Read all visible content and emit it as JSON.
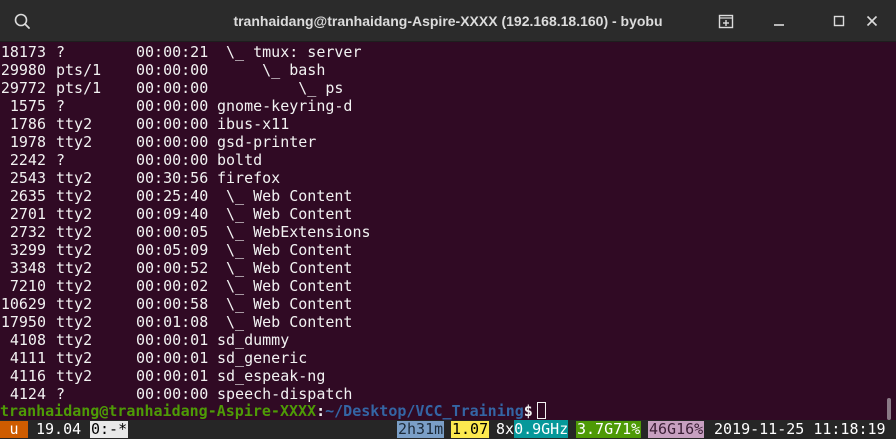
{
  "window": {
    "title": "tranhaidang@tranhaidang-Aspire-XXXX (192.168.18.160) - byobu",
    "icons": [
      "search-icon",
      "new-tab-icon",
      "minimize-icon",
      "maximize-icon",
      "close-icon"
    ]
  },
  "processes": [
    {
      "pid": "18173",
      "tty": "?",
      "time": "00:00:21",
      "cmd": " \\_ tmux: server"
    },
    {
      "pid": "29980",
      "tty": "pts/1",
      "time": "00:00:00",
      "cmd": "     \\_ bash"
    },
    {
      "pid": "29772",
      "tty": "pts/1",
      "time": "00:00:00",
      "cmd": "         \\_ ps"
    },
    {
      "pid": "1575",
      "tty": "?",
      "time": "00:00:00",
      "cmd": "gnome-keyring-d"
    },
    {
      "pid": "1786",
      "tty": "tty2",
      "time": "00:00:00",
      "cmd": "ibus-x11"
    },
    {
      "pid": "1978",
      "tty": "tty2",
      "time": "00:00:00",
      "cmd": "gsd-printer"
    },
    {
      "pid": "2242",
      "tty": "?",
      "time": "00:00:00",
      "cmd": "boltd"
    },
    {
      "pid": "2543",
      "tty": "tty2",
      "time": "00:30:56",
      "cmd": "firefox"
    },
    {
      "pid": "2635",
      "tty": "tty2",
      "time": "00:25:40",
      "cmd": " \\_ Web Content"
    },
    {
      "pid": "2701",
      "tty": "tty2",
      "time": "00:09:40",
      "cmd": " \\_ Web Content"
    },
    {
      "pid": "2732",
      "tty": "tty2",
      "time": "00:00:05",
      "cmd": " \\_ WebExtensions"
    },
    {
      "pid": "3299",
      "tty": "tty2",
      "time": "00:05:09",
      "cmd": " \\_ Web Content"
    },
    {
      "pid": "3348",
      "tty": "tty2",
      "time": "00:00:52",
      "cmd": " \\_ Web Content"
    },
    {
      "pid": "7210",
      "tty": "tty2",
      "time": "00:00:02",
      "cmd": " \\_ Web Content"
    },
    {
      "pid": "10629",
      "tty": "tty2",
      "time": "00:00:58",
      "cmd": " \\_ Web Content"
    },
    {
      "pid": "17950",
      "tty": "tty2",
      "time": "00:01:08",
      "cmd": " \\_ Web Content"
    },
    {
      "pid": "4108",
      "tty": "tty2",
      "time": "00:00:01",
      "cmd": "sd_dummy"
    },
    {
      "pid": "4111",
      "tty": "tty2",
      "time": "00:00:01",
      "cmd": "sd_generic"
    },
    {
      "pid": "4116",
      "tty": "tty2",
      "time": "00:00:01",
      "cmd": "sd_espeak-ng"
    },
    {
      "pid": "4124",
      "tty": "?",
      "time": "00:00:00",
      "cmd": "speech-dispatch"
    }
  ],
  "prompt": {
    "user_host": "tranhaidang@tranhaidang-Aspire-XXXX",
    "colon": ":",
    "path": "~/Desktop/VCC_Training",
    "dollar": "$"
  },
  "statusbar": {
    "logo": "u",
    "release": "19.04",
    "window": "0:-*",
    "uptime": "2h31m",
    "load": "1.07",
    "cpu_count": "8x",
    "cpu_freq": "0.9GHz",
    "memory": "3.7G71%",
    "disk": "46G16%",
    "datetime": "2019-11-25 11:18:19"
  },
  "colors": {
    "terminal_bg": "#300a24",
    "titlebar_bg": "#2b2b2b",
    "prompt_user": "#4e9a06",
    "prompt_path": "#3465a4",
    "status_logo": "#ce5c00",
    "status_uptime": "#7b9fc7",
    "status_load": "#fce94f",
    "status_cpu_freq": "#06989a",
    "status_memory": "#4e9a06",
    "status_disk": "#c7a0c0"
  }
}
